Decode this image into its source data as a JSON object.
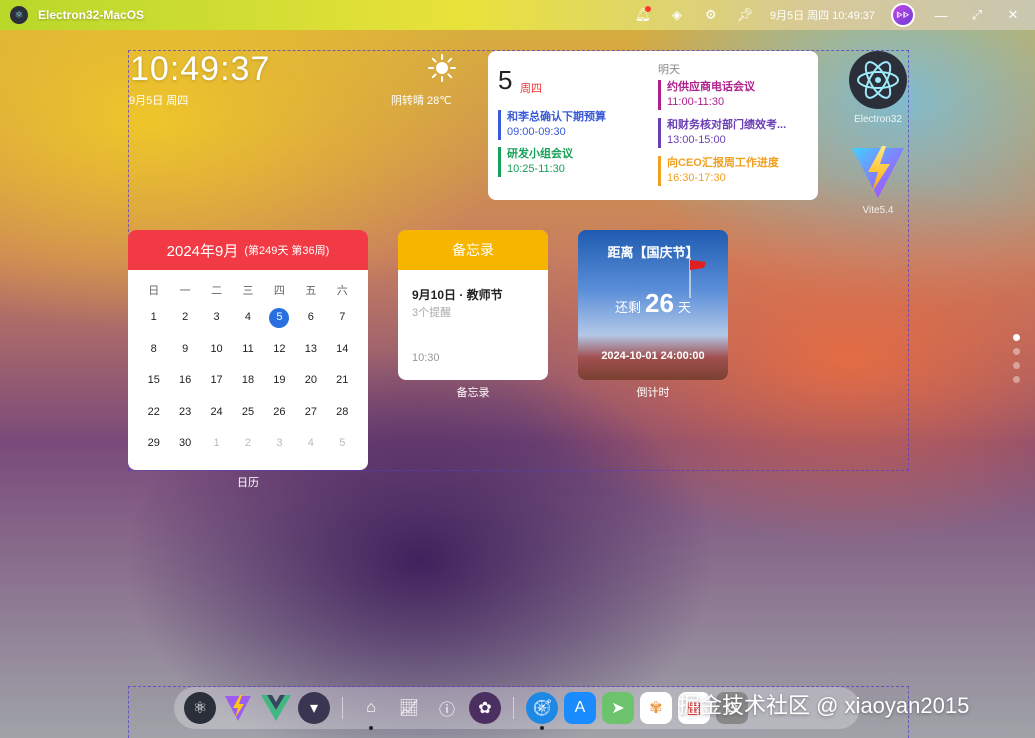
{
  "titlebar": {
    "app_title": "Electron32-MacOS",
    "datetime": "9月5日 周四 10:49:37",
    "avatar_text": "ᐈᐈ",
    "icons": [
      "bell-icon",
      "skin-icon",
      "settings-icon",
      "pin-icon",
      "minimize-icon",
      "maximize-icon",
      "close-icon"
    ]
  },
  "clock": {
    "time": "10:49:37",
    "date": "9月5日 周四"
  },
  "weather": {
    "text": "阴转晴 28℃",
    "icon": "sun-icon"
  },
  "schedule": {
    "day": "5",
    "weekday": "周四",
    "tomorrow_label": "明天",
    "today_events": [
      {
        "title": "和李总确认下期预算",
        "time": "09:00-09:30",
        "color": "#3a5bd9"
      },
      {
        "title": "研发小组会议",
        "time": "10:25-11:30",
        "color": "#18a058"
      }
    ],
    "tomorrow_events": [
      {
        "title": "约供应商电话会议",
        "time": "11:00-11:30",
        "color": "#b0208c"
      },
      {
        "title": "和财务核对部门绩效考...",
        "time": "13:00-15:00",
        "color": "#6a3fb5"
      },
      {
        "title": "向CEO汇报周工作进度",
        "time": "16:30-17:30",
        "color": "#f0a020"
      }
    ]
  },
  "side_apps": [
    {
      "label": "Electron32",
      "icon": "electron-icon"
    },
    {
      "label": "Vite5.4",
      "icon": "vite-icon"
    }
  ],
  "calendar": {
    "month": "2024年9月",
    "sub": "(第249天 第36周)",
    "weekdays": [
      "日",
      "一",
      "二",
      "三",
      "四",
      "五",
      "六"
    ],
    "days": [
      "1",
      "2",
      "3",
      "4",
      "5",
      "6",
      "7",
      "8",
      "9",
      "10",
      "11",
      "12",
      "13",
      "14",
      "15",
      "16",
      "17",
      "18",
      "19",
      "20",
      "21",
      "22",
      "23",
      "24",
      "25",
      "26",
      "27",
      "28",
      "29",
      "30",
      "1",
      "2",
      "3",
      "4",
      "5"
    ],
    "today": "5",
    "label": "日历"
  },
  "memo": {
    "header": "备忘录",
    "title": "9月10日 · 教师节",
    "sub": "3个提醒",
    "time": "10:30",
    "label": "备忘录"
  },
  "countdown": {
    "title": "距离【国庆节】",
    "remain_prefix": "还剩",
    "days": "26",
    "remain_suffix": "天",
    "target": "2024-10-01 24:00:00",
    "label": "倒计时"
  },
  "page_indicator": {
    "total": 4,
    "active": 1
  },
  "dock": {
    "apps": [
      "electron-icon",
      "vite-icon",
      "vue-icon",
      "vcode-icon",
      "home-icon",
      "chart-icon",
      "info-icon",
      "palette-icon",
      "safari-icon",
      "appstore-icon",
      "maps-icon",
      "photos-icon",
      "calendar-icon",
      "settings-icon"
    ]
  },
  "watermark": "掘金技术社区 @ xiaoyan2015"
}
